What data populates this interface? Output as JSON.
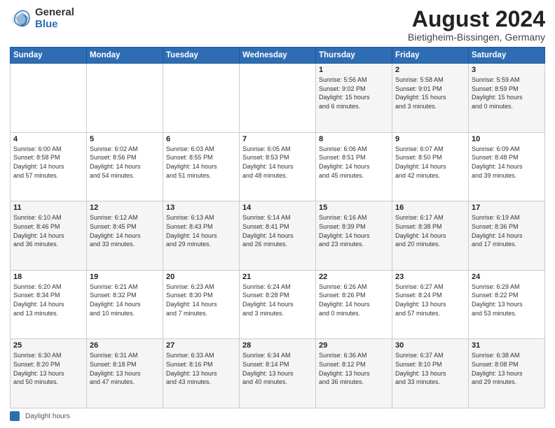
{
  "header": {
    "logo_general": "General",
    "logo_blue": "Blue",
    "main_title": "August 2024",
    "subtitle": "Bietigheim-Bissingen, Germany"
  },
  "footer": {
    "label": "Daylight hours"
  },
  "calendar": {
    "headers": [
      "Sunday",
      "Monday",
      "Tuesday",
      "Wednesday",
      "Thursday",
      "Friday",
      "Saturday"
    ],
    "rows": [
      [
        {
          "day": "",
          "lines": []
        },
        {
          "day": "",
          "lines": []
        },
        {
          "day": "",
          "lines": []
        },
        {
          "day": "",
          "lines": []
        },
        {
          "day": "1",
          "lines": [
            "Sunrise: 5:56 AM",
            "Sunset: 9:02 PM",
            "Daylight: 15 hours",
            "and 6 minutes."
          ]
        },
        {
          "day": "2",
          "lines": [
            "Sunrise: 5:58 AM",
            "Sunset: 9:01 PM",
            "Daylight: 15 hours",
            "and 3 minutes."
          ]
        },
        {
          "day": "3",
          "lines": [
            "Sunrise: 5:59 AM",
            "Sunset: 8:59 PM",
            "Daylight: 15 hours",
            "and 0 minutes."
          ]
        }
      ],
      [
        {
          "day": "4",
          "lines": [
            "Sunrise: 6:00 AM",
            "Sunset: 8:58 PM",
            "Daylight: 14 hours",
            "and 57 minutes."
          ]
        },
        {
          "day": "5",
          "lines": [
            "Sunrise: 6:02 AM",
            "Sunset: 8:56 PM",
            "Daylight: 14 hours",
            "and 54 minutes."
          ]
        },
        {
          "day": "6",
          "lines": [
            "Sunrise: 6:03 AM",
            "Sunset: 8:55 PM",
            "Daylight: 14 hours",
            "and 51 minutes."
          ]
        },
        {
          "day": "7",
          "lines": [
            "Sunrise: 6:05 AM",
            "Sunset: 8:53 PM",
            "Daylight: 14 hours",
            "and 48 minutes."
          ]
        },
        {
          "day": "8",
          "lines": [
            "Sunrise: 6:06 AM",
            "Sunset: 8:51 PM",
            "Daylight: 14 hours",
            "and 45 minutes."
          ]
        },
        {
          "day": "9",
          "lines": [
            "Sunrise: 6:07 AM",
            "Sunset: 8:50 PM",
            "Daylight: 14 hours",
            "and 42 minutes."
          ]
        },
        {
          "day": "10",
          "lines": [
            "Sunrise: 6:09 AM",
            "Sunset: 8:48 PM",
            "Daylight: 14 hours",
            "and 39 minutes."
          ]
        }
      ],
      [
        {
          "day": "11",
          "lines": [
            "Sunrise: 6:10 AM",
            "Sunset: 8:46 PM",
            "Daylight: 14 hours",
            "and 36 minutes."
          ]
        },
        {
          "day": "12",
          "lines": [
            "Sunrise: 6:12 AM",
            "Sunset: 8:45 PM",
            "Daylight: 14 hours",
            "and 33 minutes."
          ]
        },
        {
          "day": "13",
          "lines": [
            "Sunrise: 6:13 AM",
            "Sunset: 8:43 PM",
            "Daylight: 14 hours",
            "and 29 minutes."
          ]
        },
        {
          "day": "14",
          "lines": [
            "Sunrise: 6:14 AM",
            "Sunset: 8:41 PM",
            "Daylight: 14 hours",
            "and 26 minutes."
          ]
        },
        {
          "day": "15",
          "lines": [
            "Sunrise: 6:16 AM",
            "Sunset: 8:39 PM",
            "Daylight: 14 hours",
            "and 23 minutes."
          ]
        },
        {
          "day": "16",
          "lines": [
            "Sunrise: 6:17 AM",
            "Sunset: 8:38 PM",
            "Daylight: 14 hours",
            "and 20 minutes."
          ]
        },
        {
          "day": "17",
          "lines": [
            "Sunrise: 6:19 AM",
            "Sunset: 8:36 PM",
            "Daylight: 14 hours",
            "and 17 minutes."
          ]
        }
      ],
      [
        {
          "day": "18",
          "lines": [
            "Sunrise: 6:20 AM",
            "Sunset: 8:34 PM",
            "Daylight: 14 hours",
            "and 13 minutes."
          ]
        },
        {
          "day": "19",
          "lines": [
            "Sunrise: 6:21 AM",
            "Sunset: 8:32 PM",
            "Daylight: 14 hours",
            "and 10 minutes."
          ]
        },
        {
          "day": "20",
          "lines": [
            "Sunrise: 6:23 AM",
            "Sunset: 8:30 PM",
            "Daylight: 14 hours",
            "and 7 minutes."
          ]
        },
        {
          "day": "21",
          "lines": [
            "Sunrise: 6:24 AM",
            "Sunset: 8:28 PM",
            "Daylight: 14 hours",
            "and 3 minutes."
          ]
        },
        {
          "day": "22",
          "lines": [
            "Sunrise: 6:26 AM",
            "Sunset: 8:26 PM",
            "Daylight: 14 hours",
            "and 0 minutes."
          ]
        },
        {
          "day": "23",
          "lines": [
            "Sunrise: 6:27 AM",
            "Sunset: 8:24 PM",
            "Daylight: 13 hours",
            "and 57 minutes."
          ]
        },
        {
          "day": "24",
          "lines": [
            "Sunrise: 6:29 AM",
            "Sunset: 8:22 PM",
            "Daylight: 13 hours",
            "and 53 minutes."
          ]
        }
      ],
      [
        {
          "day": "25",
          "lines": [
            "Sunrise: 6:30 AM",
            "Sunset: 8:20 PM",
            "Daylight: 13 hours",
            "and 50 minutes."
          ]
        },
        {
          "day": "26",
          "lines": [
            "Sunrise: 6:31 AM",
            "Sunset: 8:18 PM",
            "Daylight: 13 hours",
            "and 47 minutes."
          ]
        },
        {
          "day": "27",
          "lines": [
            "Sunrise: 6:33 AM",
            "Sunset: 8:16 PM",
            "Daylight: 13 hours",
            "and 43 minutes."
          ]
        },
        {
          "day": "28",
          "lines": [
            "Sunrise: 6:34 AM",
            "Sunset: 8:14 PM",
            "Daylight: 13 hours",
            "and 40 minutes."
          ]
        },
        {
          "day": "29",
          "lines": [
            "Sunrise: 6:36 AM",
            "Sunset: 8:12 PM",
            "Daylight: 13 hours",
            "and 36 minutes."
          ]
        },
        {
          "day": "30",
          "lines": [
            "Sunrise: 6:37 AM",
            "Sunset: 8:10 PM",
            "Daylight: 13 hours",
            "and 33 minutes."
          ]
        },
        {
          "day": "31",
          "lines": [
            "Sunrise: 6:38 AM",
            "Sunset: 8:08 PM",
            "Daylight: 13 hours",
            "and 29 minutes."
          ]
        }
      ]
    ]
  }
}
